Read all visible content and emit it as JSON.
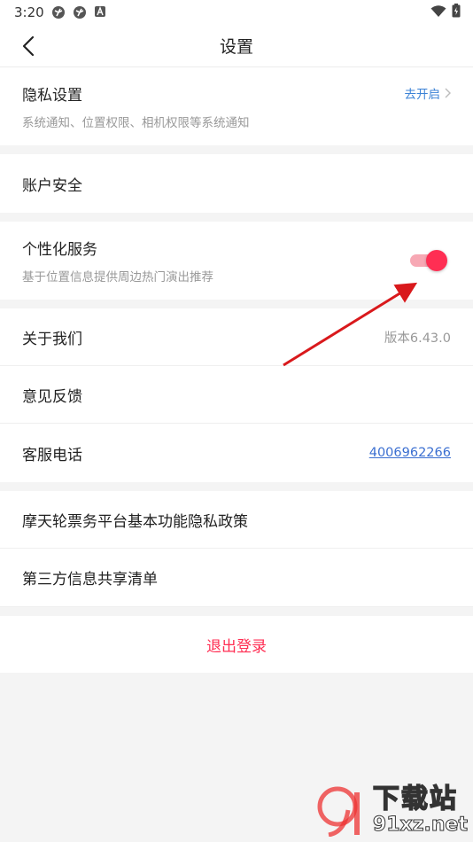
{
  "status": {
    "time": "3:20"
  },
  "nav": {
    "title": "设置"
  },
  "privacy": {
    "title": "隐私设置",
    "subtitle": "系统通知、位置权限、相机权限等系统通知",
    "action": "去开启"
  },
  "account": {
    "title": "账户安全"
  },
  "personal": {
    "title": "个性化服务",
    "subtitle": "基于位置信息提供周边热门演出推荐",
    "enabled": true
  },
  "about": {
    "title": "关于我们",
    "value": "版本6.43.0"
  },
  "feedback": {
    "title": "意见反馈"
  },
  "service": {
    "title": "客服电话",
    "phone": "4006962266"
  },
  "policy": {
    "title": "摩天轮票务平台基本功能隐私政策"
  },
  "thirdparty": {
    "title": "第三方信息共享清单"
  },
  "logout": {
    "label": "退出登录"
  },
  "watermark": {
    "big": "下载站",
    "small": "91xz.net",
    "logo": "9"
  },
  "colors": {
    "accent": "#ff2e53",
    "link": "#3b6fd1",
    "annotation_arrow": "#d9191c"
  }
}
